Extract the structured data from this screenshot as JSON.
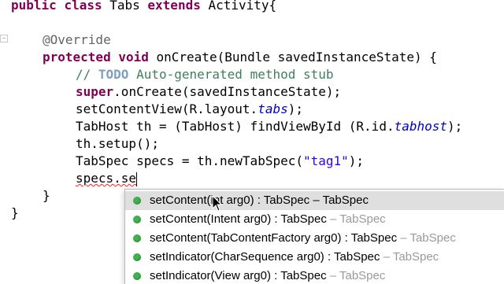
{
  "editor": {
    "lines": [
      {
        "text": "public class Tabs extends Activity{"
      },
      {
        "text": ""
      },
      {
        "text": "@Override"
      },
      {
        "text": "protected void onCreate(Bundle savedInstanceState) {"
      },
      {
        "text": "// TODO Auto-generated method stub"
      },
      {
        "text": "super.onCreate(savedInstanceState);"
      },
      {
        "text": "setContentView(R.layout.tabs);"
      },
      {
        "text": "TabHost th = (TabHost) findViewById (R.id.tabhost);"
      },
      {
        "text": "th.setup();"
      },
      {
        "text": "TabSpec specs = th.newTabSpec(\"tag1\");"
      },
      {
        "text": "specs.se"
      },
      {
        "text": "}"
      },
      {
        "text": "}"
      }
    ],
    "fold_marker": "−"
  },
  "autocomplete": {
    "items": [
      {
        "signature": "setContent(int arg0) : TabSpec",
        "declaring": " – TabSpec",
        "selected": true
      },
      {
        "signature": "setContent(Intent arg0) : TabSpec",
        "declaring": " – TabSpec",
        "selected": false
      },
      {
        "signature": "setContent(TabContentFactory arg0) : TabSpec",
        "declaring": " – TabSpec",
        "selected": false
      },
      {
        "signature": "setIndicator(CharSequence arg0) : TabSpec",
        "declaring": " – TabSpec",
        "selected": false
      },
      {
        "signature": "setIndicator(View arg0) : TabSpec",
        "declaring": " – TabSpec",
        "selected": false
      }
    ],
    "icon": "public-method-icon",
    "icon_color": "#3fb34f"
  },
  "colors": {
    "keyword": "#7f0055",
    "annotation": "#646464",
    "comment": "#3f7f5f",
    "string": "#2a00ff",
    "field": "#0000c0",
    "selection": "#dfdfdf"
  },
  "pointer": "arrow-cursor-icon"
}
